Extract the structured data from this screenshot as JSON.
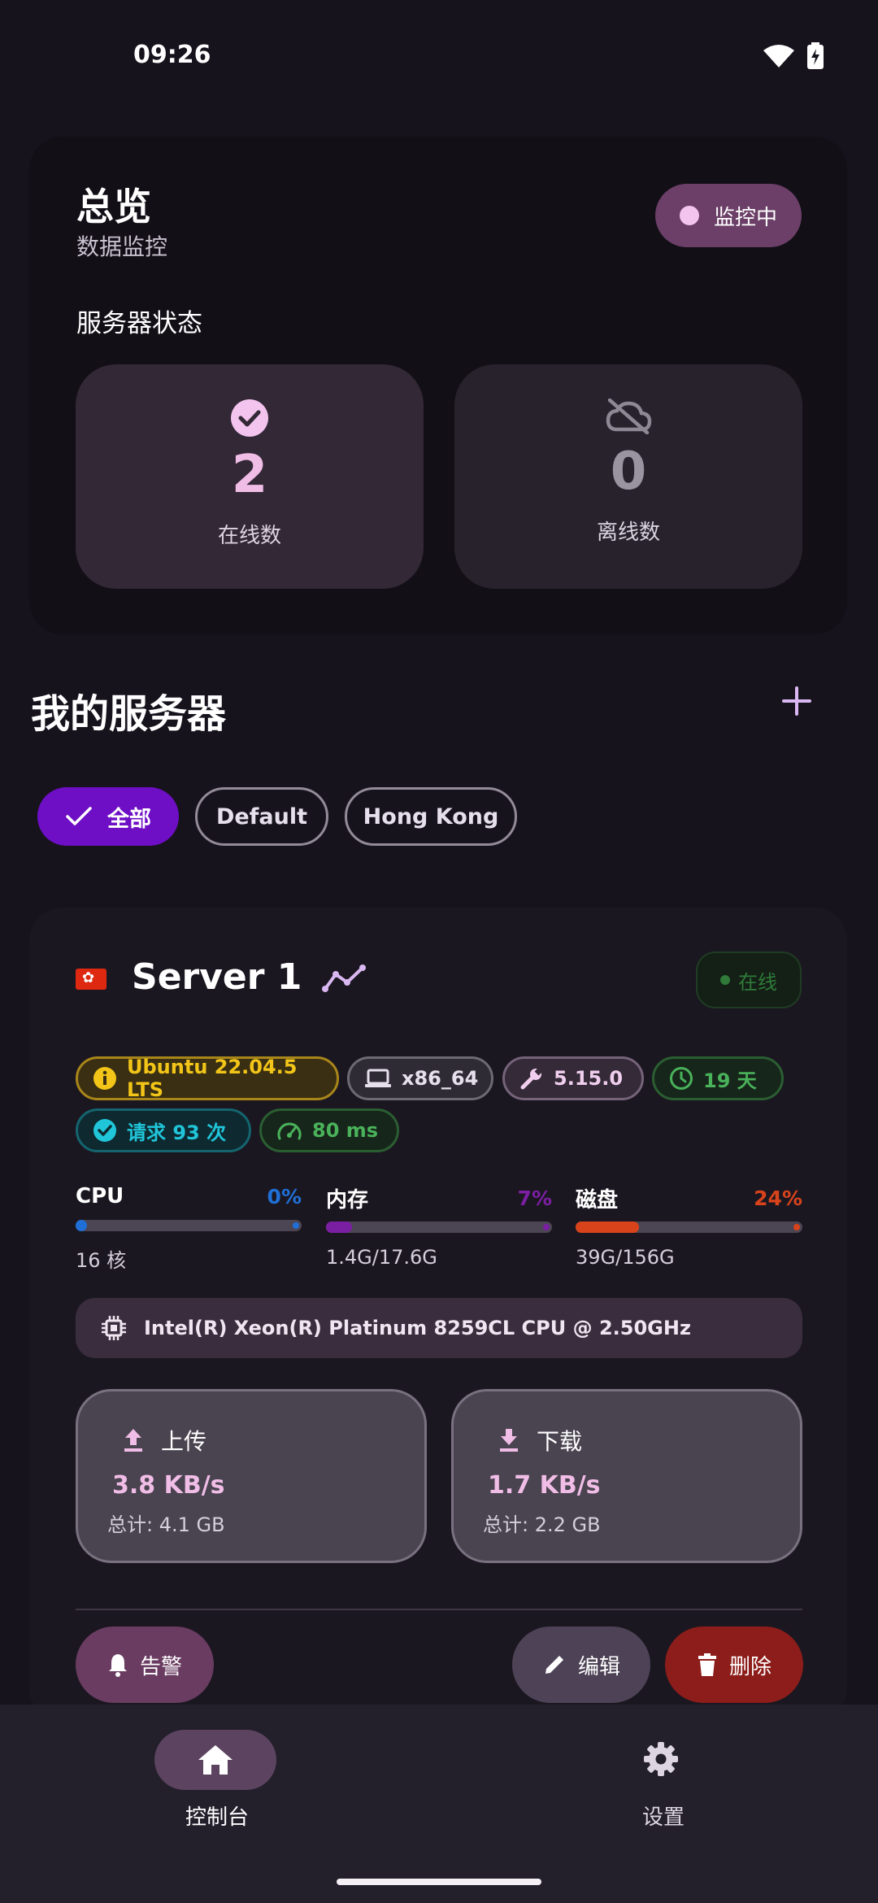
{
  "status_bar": {
    "time": "09:26"
  },
  "overview": {
    "title": "总览",
    "subtitle": "数据监控",
    "monitor_label": "监控中",
    "section_title": "服务器状态",
    "online": {
      "value": "2",
      "label": "在线数"
    },
    "offline": {
      "value": "0",
      "label": "离线数"
    }
  },
  "servers_section": {
    "title": "我的服务器",
    "filters": [
      {
        "label": "全部",
        "selected": true
      },
      {
        "label": "Default",
        "selected": false
      },
      {
        "label": "Hong Kong",
        "selected": false
      }
    ]
  },
  "server": {
    "flag": "🇭🇰",
    "name": "Server 1",
    "status": "在线",
    "tags": {
      "os": "Ubuntu 22.04.5 LTS",
      "arch": "x86_64",
      "kernel": "5.15.0",
      "uptime": "19 天",
      "requests": "请求 93 次",
      "ping": "80 ms"
    },
    "meters": {
      "cpu": {
        "name": "CPU",
        "percent_text": "0%",
        "percent": 0,
        "sub": "16 核",
        "color": "#1f6fd6"
      },
      "mem": {
        "name": "内存",
        "percent_text": "7%",
        "percent": 7,
        "sub": "1.4G/17.6G",
        "color": "#7b1fa2"
      },
      "disk": {
        "name": "磁盘",
        "percent_text": "24%",
        "percent": 24,
        "sub": "39G/156G",
        "color": "#d8431b"
      }
    },
    "cpu_model": "Intel(R) Xeon(R) Platinum 8259CL CPU @ 2.50GHz",
    "upload": {
      "label": "上传",
      "speed": "3.8 KB/s",
      "total": "总计: 4.1 GB"
    },
    "download": {
      "label": "下载",
      "speed": "1.7 KB/s",
      "total": "总计: 2.2 GB"
    },
    "actions": {
      "alert": "告警",
      "edit": "编辑",
      "delete": "删除"
    }
  },
  "nav": {
    "home": "控制台",
    "settings": "设置"
  },
  "colors": {
    "background": "#17131d",
    "accent_pink": "#f0bde6",
    "chip_selected": "#6e0fc6",
    "delete": "#8c1d1a"
  },
  "icons": [
    "wifi-icon",
    "battery-icon",
    "check-circle-icon",
    "cloud-off-icon",
    "plus-icon",
    "check-icon",
    "trend-icon",
    "info-icon",
    "laptop-icon",
    "wrench-icon",
    "clock-icon",
    "verified-icon",
    "speedometer-icon",
    "chip-icon",
    "upload-icon",
    "download-icon",
    "bell-icon",
    "pencil-icon",
    "trash-icon",
    "home-icon",
    "gear-icon"
  ]
}
